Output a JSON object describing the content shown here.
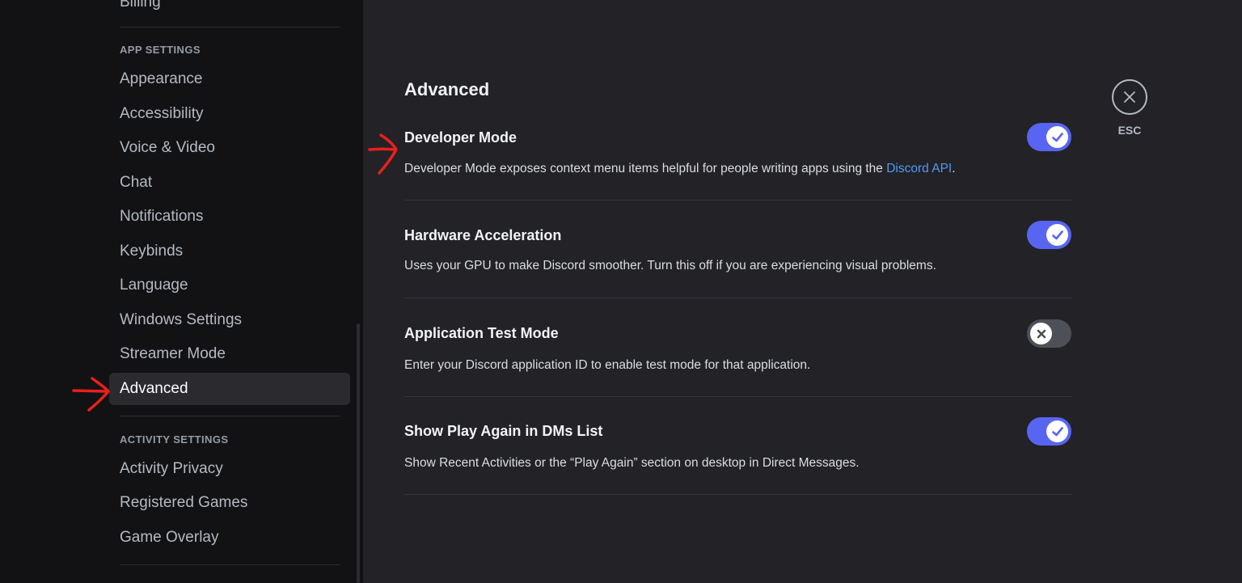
{
  "sidebar": {
    "partial_top_label": "Billing",
    "app_settings_header": "APP SETTINGS",
    "app_items": [
      {
        "label": "Appearance"
      },
      {
        "label": "Accessibility"
      },
      {
        "label": "Voice & Video"
      },
      {
        "label": "Chat"
      },
      {
        "label": "Notifications"
      },
      {
        "label": "Keybinds"
      },
      {
        "label": "Language"
      },
      {
        "label": "Windows Settings"
      },
      {
        "label": "Streamer Mode"
      },
      {
        "label": "Advanced"
      }
    ],
    "selected_item": "Advanced",
    "activity_settings_header": "ACTIVITY SETTINGS",
    "activity_items": [
      {
        "label": "Activity Privacy"
      },
      {
        "label": "Registered Games"
      },
      {
        "label": "Game Overlay"
      }
    ]
  },
  "main": {
    "title": "Advanced",
    "settings": [
      {
        "title": "Developer Mode",
        "description_before": "Developer Mode exposes context menu items helpful for people writing apps using the ",
        "link": "Discord API",
        "description_after": ".",
        "enabled": true
      },
      {
        "title": "Hardware Acceleration",
        "description": "Uses your GPU to make Discord smoother. Turn this off if you are experiencing visual problems.",
        "enabled": true
      },
      {
        "title": "Application Test Mode",
        "description": "Enter your Discord application ID to enable test mode for that application.",
        "enabled": false
      },
      {
        "title": "Show Play Again in DMs List",
        "description": "Show Recent Activities or the “Play Again” section on desktop in Direct Messages.",
        "enabled": true
      }
    ]
  },
  "close": {
    "label": "ESC"
  },
  "colors": {
    "accent": "#5865f2",
    "link": "#4f9cf2",
    "annotation": "#e8201c",
    "sidebar_bg": "#121214",
    "content_bg": "#222227"
  },
  "icons": {
    "close": "close-icon",
    "toggle_on": "check-icon",
    "toggle_off": "x-icon",
    "annotation": "red-arrow-annotation"
  }
}
